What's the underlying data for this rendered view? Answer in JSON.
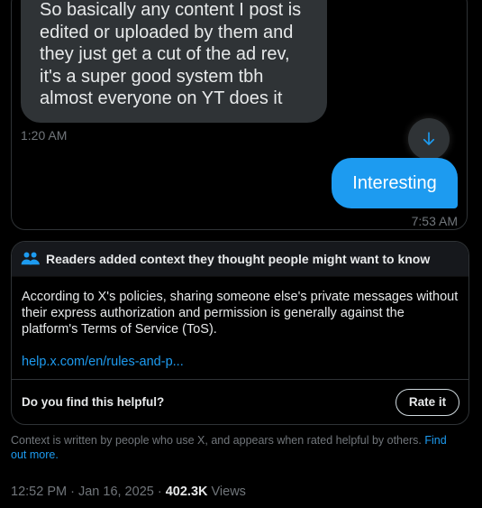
{
  "chat": {
    "incoming_message": "So basically any content I post is edited or uploaded by them and they just get a cut of the ad rev, it's a super good system tbh almost everyone on YT does it",
    "incoming_time": "1:20 AM",
    "scroll_icon": "arrow-down-icon",
    "outgoing_message": "Interesting",
    "outgoing_time": "7:53 AM"
  },
  "community_note": {
    "icon": "people-icon",
    "title": "Readers added context they thought people might want to know",
    "body": "According to X's policies, sharing someone else's private messages without their express authorization and permission is generally against the platform's Terms of Service (ToS).",
    "link": "help.x.com/en/rules-and-p...",
    "question": "Do you find this helpful?",
    "rate_button": "Rate it"
  },
  "context_text": {
    "text": "Context is written by people who use X, and appears when rated helpful by others.",
    "link": "Find out more."
  },
  "post_meta": {
    "time": "12:52 PM",
    "date": "Jan 16, 2025",
    "views_count": "402.3K",
    "views_label": "Views"
  },
  "colors": {
    "accent": "#1d9bf0",
    "background": "#000000",
    "bubble_gray": "#2f3336",
    "muted_text": "#71767b"
  }
}
